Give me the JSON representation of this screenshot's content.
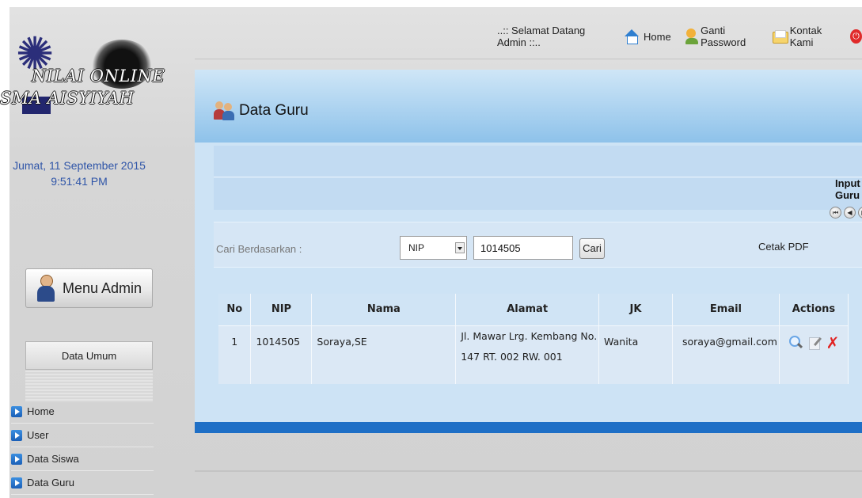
{
  "logo": {
    "line1": "NILAI ONLINE",
    "line2": "SMA AISYIYAH"
  },
  "sidebar": {
    "date": "Jumat, 11 September 2015",
    "time": "9:51:41 PM",
    "menu_admin_label": "Menu Admin",
    "section_title": "Data Umum",
    "items": [
      {
        "label": "Home"
      },
      {
        "label": "User"
      },
      {
        "label": "Data Siswa"
      },
      {
        "label": "Data Guru"
      }
    ]
  },
  "topbar": {
    "welcome": "..:: Selamat Datang Admin ::..",
    "home": "Home",
    "ganti_password": "Ganti Password",
    "kontak_kami": "Kontak Kami",
    "power_icon": "power-icon"
  },
  "panel": {
    "title": "Data Guru",
    "input_guru": "Input Guru",
    "search": {
      "label": "Cari Berdasarkan :",
      "select_value": "NIP",
      "input_value": "1014505",
      "button": "Cari",
      "cetak": "Cetak PDF"
    },
    "table": {
      "headers": [
        "No",
        "NIP",
        "Nama",
        "Alamat",
        "JK",
        "Email",
        "Actions"
      ],
      "rows": [
        {
          "no": "1",
          "nip": "1014505",
          "nama": "Soraya,SE",
          "alamat": "Jl. Mawar Lrg. Kembang No. 147 RT. 002 RW. 001",
          "jk": "Wanita",
          "email": "soraya@gmail.com"
        }
      ]
    }
  },
  "colors": {
    "accent_blue": "#1e6fc6",
    "panel_bg": "#cde3f5",
    "date_text": "#2f55a8",
    "delete_red": "#e12222"
  }
}
